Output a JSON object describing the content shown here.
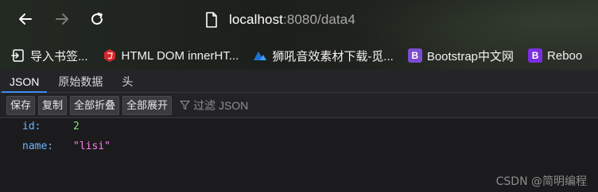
{
  "browser": {
    "url_host": "localhost",
    "url_rest": ":8080/data4"
  },
  "bookmarks": [
    {
      "label": "导入书签...",
      "icon": "import-icon"
    },
    {
      "label": "HTML DOM innerHT...",
      "icon": "html-site-icon"
    },
    {
      "label": "狮吼音效素材下载-觅...",
      "icon": "sound-site-icon"
    },
    {
      "label": "Bootstrap中文网",
      "icon": "bootstrap-icon"
    },
    {
      "label": "Reboo",
      "icon": "bootstrap-icon"
    }
  ],
  "viewer": {
    "tabs": [
      "JSON",
      "原始数据",
      "头"
    ],
    "toolbar": {
      "save": "保存",
      "copy": "复制",
      "collapse_all": "全部折叠",
      "expand_all": "全部展开",
      "filter": "过滤 JSON"
    },
    "json": [
      {
        "key": "id:",
        "value": "2",
        "type": "number"
      },
      {
        "key": "name:",
        "value": "\"lisi\"",
        "type": "string"
      }
    ]
  },
  "watermark": "CSDN @简明编程",
  "colors": {
    "accent": "#3d8ef0",
    "json_key": "#6cb8ff",
    "json_number": "#86de74",
    "json_string": "#ff7de9"
  }
}
